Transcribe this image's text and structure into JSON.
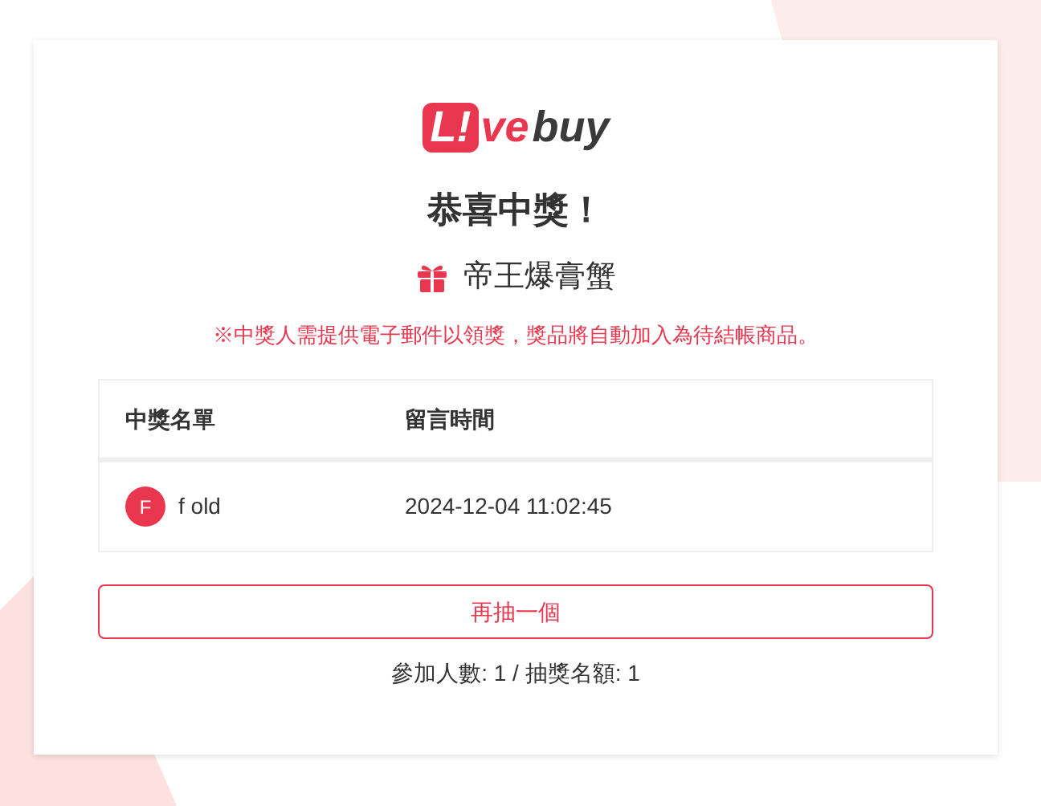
{
  "logo": {
    "badge": "L!",
    "accent": "ve",
    "rest": "buy"
  },
  "title": "恭喜中獎！",
  "prize": "帝王爆膏蟹",
  "notice": "※中獎人需提供電子郵件以領獎，獎品將自動加入為待結帳商品。",
  "table": {
    "columns": [
      "中獎名單",
      "留言時間"
    ],
    "rows": [
      {
        "avatar": "F",
        "name": "f old",
        "time": "2024-12-04 11:02:45"
      }
    ]
  },
  "button": "再抽一個",
  "summary": "參加人數: 1 / 抽獎名額: 1"
}
